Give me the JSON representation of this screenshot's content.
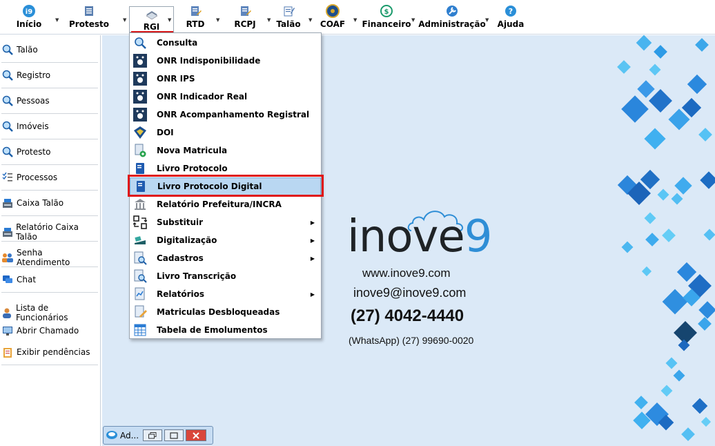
{
  "toolbar": {
    "items": [
      {
        "label": "Início",
        "icon": "i9-logo-icon"
      },
      {
        "label": "Protesto",
        "icon": "document-stack-icon"
      },
      {
        "label": "RGI",
        "icon": "books-icon"
      },
      {
        "label": "RTD",
        "icon": "document-edit-icon"
      },
      {
        "label": "RCPJ",
        "icon": "document-edit-icon"
      },
      {
        "label": "Talão",
        "icon": "notepad-icon"
      },
      {
        "label": "COAF",
        "icon": "coaf-seal-icon"
      },
      {
        "label": "Financeiro",
        "icon": "money-cycle-icon"
      },
      {
        "label": "Administração",
        "icon": "wrench-icon"
      },
      {
        "label": "Ajuda",
        "icon": "help-icon"
      }
    ],
    "active": "RGI"
  },
  "sidebar": {
    "items": [
      {
        "label": "Talão",
        "icon": "search-icon"
      },
      {
        "label": "Registro",
        "icon": "search-icon"
      },
      {
        "label": "Pessoas",
        "icon": "search-icon"
      },
      {
        "label": "Imóveis",
        "icon": "search-icon"
      },
      {
        "label": "Protesto",
        "icon": "search-icon"
      },
      {
        "label": "Processos",
        "icon": "checklist-icon"
      },
      {
        "label": "Caixa Talão",
        "icon": "cash-register-icon"
      },
      {
        "label": "Relatório Caixa Talão",
        "icon": "cash-register-icon"
      },
      {
        "label": "Senha Atendimento",
        "icon": "people-icon"
      },
      {
        "label": "Chat",
        "icon": "chat-icon"
      },
      {
        "label": "Lista de Funcionários",
        "icon": "person-icon"
      },
      {
        "label": "Abrir Chamado",
        "icon": "monitor-icon"
      },
      {
        "label": "Exibir pendências",
        "icon": "clipboard-icon"
      }
    ]
  },
  "dropdown": {
    "items": [
      {
        "label": "Consulta",
        "icon": "search-icon",
        "submenu": false
      },
      {
        "label": "ONR Indisponibilidade",
        "icon": "onr-icon",
        "submenu": false
      },
      {
        "label": "ONR IPS",
        "icon": "onr-icon",
        "submenu": false
      },
      {
        "label": "ONR Indicador Real",
        "icon": "onr-icon",
        "submenu": false
      },
      {
        "label": "ONR Acompanhamento Registral",
        "icon": "onr-icon",
        "submenu": false
      },
      {
        "label": "DOI",
        "icon": "doi-emblem-icon",
        "submenu": false
      },
      {
        "label": "Nova Matricula",
        "icon": "new-document-icon",
        "submenu": false
      },
      {
        "label": "Livro Protocolo",
        "icon": "book-icon",
        "submenu": false
      },
      {
        "label": "Livro Protocolo Digital",
        "icon": "book-icon",
        "submenu": false,
        "highlighted": true
      },
      {
        "label": "Relatório Prefeitura/INCRA",
        "icon": "building-icon",
        "submenu": false
      },
      {
        "label": "Substituir",
        "icon": "swap-icon",
        "submenu": true
      },
      {
        "label": "Digitalização",
        "icon": "scanner-icon",
        "submenu": true
      },
      {
        "label": "Cadastros",
        "icon": "document-search-icon",
        "submenu": true
      },
      {
        "label": "Livro Transcrição",
        "icon": "document-search-icon",
        "submenu": false
      },
      {
        "label": "Relatórios",
        "icon": "chart-document-icon",
        "submenu": true
      },
      {
        "label": "Matriculas Desbloqueadas",
        "icon": "pencil-document-icon",
        "submenu": false
      },
      {
        "label": "Tabela de Emolumentos",
        "icon": "table-icon",
        "submenu": false
      }
    ]
  },
  "brand": {
    "name_main": "inove",
    "name_digit": "9",
    "website": "www.inove9.com",
    "email": "inove9@inove9.com",
    "phone": "(27) 4042-4440",
    "whatsapp": "(WhatsApp) (27) 99690-0020"
  },
  "mini_window": {
    "title": "Ad..."
  },
  "colors": {
    "accent_blue": "#2f8ed6",
    "highlight_red": "#e01414",
    "menu_selection": "#b9d7f2",
    "background": "#dbe9f7"
  }
}
